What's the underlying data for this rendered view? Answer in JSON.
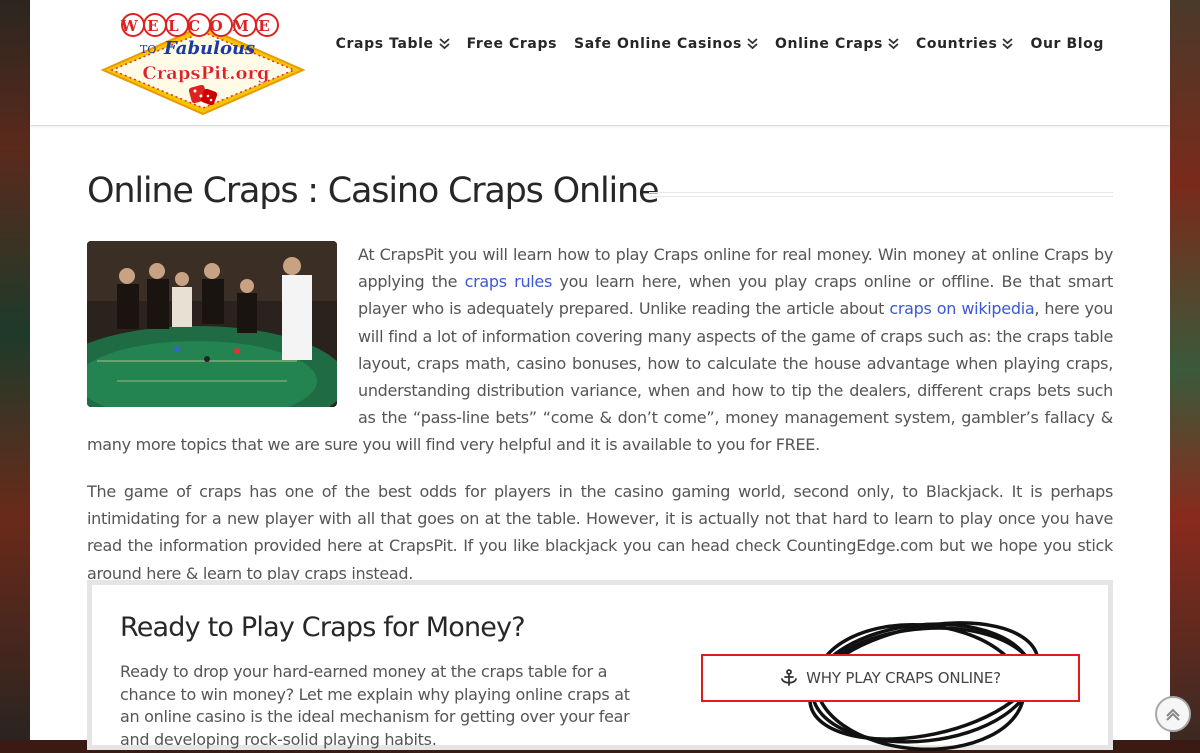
{
  "header": {
    "logo": {
      "welcome": "WELCOME",
      "to": "TO",
      "fabulous": "Fabulous",
      "brand": "CrapsPit.org"
    },
    "nav": [
      {
        "label": "Craps Table",
        "has_dropdown": true,
        "icon": "double-chevron-down-icon"
      },
      {
        "label": "Free Craps",
        "has_dropdown": false
      },
      {
        "label": "Safe Online Casinos",
        "has_dropdown": true,
        "icon": "double-chevron-down-icon"
      },
      {
        "label": "Online Craps",
        "has_dropdown": true,
        "icon": "double-chevron-down-icon"
      },
      {
        "label": "Countries",
        "has_dropdown": true,
        "icon": "double-chevron-down-icon"
      },
      {
        "label": "Our Blog",
        "has_dropdown": false
      }
    ]
  },
  "page": {
    "title": "Online Craps : Casino Craps Online",
    "intro": {
      "t1": "At CrapsPit you will learn how to play Craps online for real money. Win money at online Craps by applying the ",
      "link1": "craps rules",
      "t2": " you learn here, when you play craps online or offline. Be that smart player who is adequately prepared.  Unlike reading the article about ",
      "link2": "craps on wikipedia",
      "t3": ", here you will find a lot of information covering many aspects of the game of craps such as: the craps table layout, craps math, casino bonuses, how to calculate the house advantage when playing craps, understanding distribution variance, when and how to tip the dealers, different craps bets such as the “pass-line bets” “come & don’t come”, money management system, gambler’s fallacy & many more topics that we are sure you will find very helpful and it is available to you for FREE."
    },
    "paragraph2": "The game of craps has one of the best odds for players in the casino gaming world, second only, to Blackjack. It is perhaps intimidating for a new player with all that goes on at the table. However, it is actually not that hard to learn to play once you have read the information provided here at CrapsPit. If you like blackjack you can head check  CountingEdge.com but we hope you stick around here & learn to play craps instead."
  },
  "promo": {
    "title": "Ready to Play Craps for Money?",
    "text": "Ready to drop your hard-earned money at the craps table for a chance to win money? Let me explain why playing online craps at an online casino is the ideal mechanism for getting over your fear and developing rock-solid playing habits.",
    "button_label": "WHY PLAY CRAPS ONLINE?",
    "button_icon": "anchor-icon"
  },
  "colors": {
    "link": "#3b58d6",
    "button_border": "#e01b1b",
    "text": "#555555",
    "heading": "#272727"
  }
}
